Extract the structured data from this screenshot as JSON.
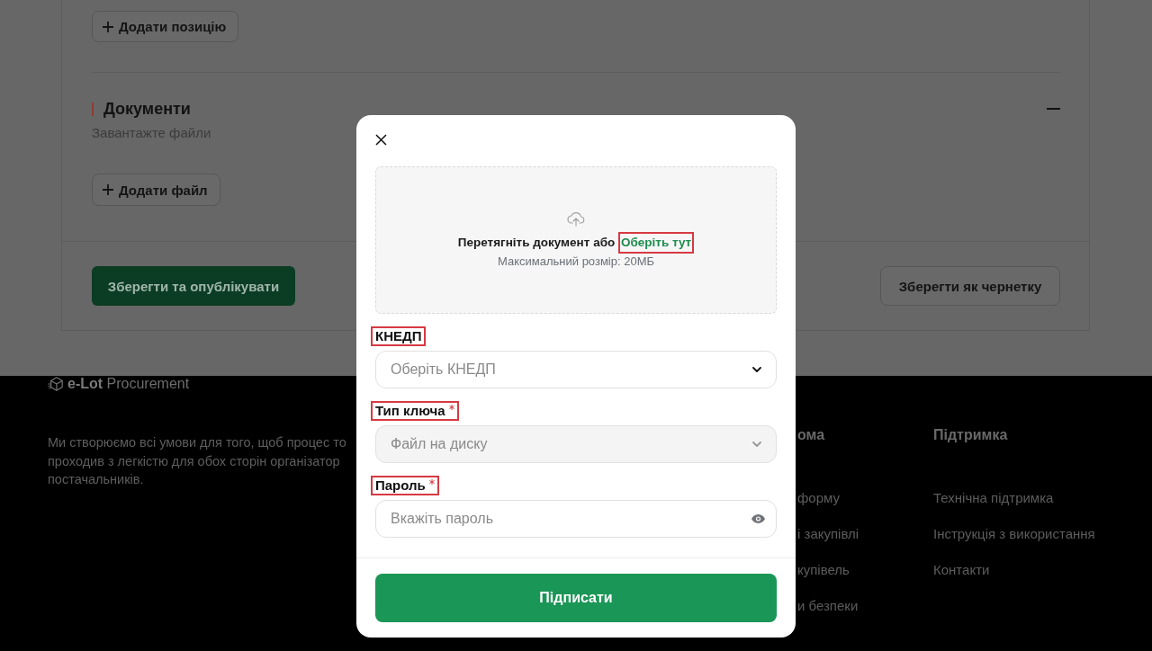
{
  "page": {
    "add_item_button": {
      "label": "Додати позицію"
    },
    "documents_section": {
      "title": "Документи",
      "subtitle": "Завантажте файли",
      "expanded": true,
      "add_file_button": {
        "label": "Додати файл"
      }
    },
    "actions": [
      {
        "kind": "primary",
        "label": "Зберегти та опублікувати"
      },
      {
        "kind": "secondary",
        "label": "Зберегти як чернетку"
      }
    ]
  },
  "footer": {
    "brand": "**e-Lot** Procurement",
    "description": [
      "Ми створюємо всі умови для того, щоб процес то",
      "проходив з легкістю для обох сторін організатор",
      "постачальників."
    ],
    "columns": [
      {
        "title": "ома",
        "links": [
          "форму",
          "і закупівлі",
          "купівель",
          "и безпеки"
        ]
      },
      {
        "title": "Підтримка",
        "links": [
          "Технічна підтримка",
          "Інструкція з використання",
          "Контакти"
        ]
      }
    ]
  },
  "modal": {
    "upload": {
      "prompt": "Перетягніть документ або",
      "link": {
        "label": "Оберіть тут",
        "highlighted": true
      },
      "hint": "Максимальний розмір: 20МБ"
    },
    "fields": [
      {
        "kind": "select",
        "label": "КНЕДП",
        "required": false,
        "highlighted": true,
        "placeholder": "Оберіть КНЕДП",
        "disabled": false
      },
      {
        "kind": "select",
        "label": "Тип ключа",
        "required": true,
        "highlighted": true,
        "value": "Файл на диску",
        "disabled": true
      },
      {
        "kind": "password",
        "label": "Пароль",
        "required": true,
        "highlighted": true,
        "placeholder": "Вкажіть пароль"
      }
    ],
    "submit": {
      "label": "Підписати"
    }
  }
}
